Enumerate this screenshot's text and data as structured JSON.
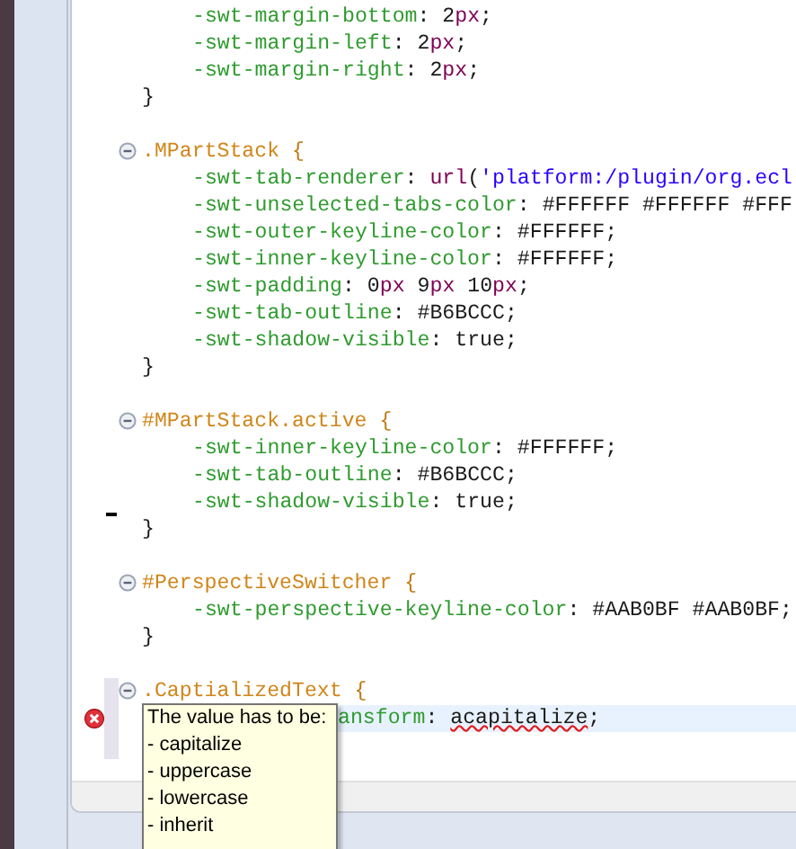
{
  "editor": {
    "lines": [
      {
        "kind": "decl",
        "tokens": [
          {
            "kind": "property",
            "text": "-swt-margin-bottom"
          },
          {
            "kind": "punct",
            "text": ": "
          },
          {
            "kind": "number",
            "text": "2"
          },
          {
            "kind": "unit",
            "text": "px"
          },
          {
            "kind": "punct",
            "text": ";"
          }
        ]
      },
      {
        "kind": "decl",
        "tokens": [
          {
            "kind": "property",
            "text": "-swt-margin-left"
          },
          {
            "kind": "punct",
            "text": ": "
          },
          {
            "kind": "number",
            "text": "2"
          },
          {
            "kind": "unit",
            "text": "px"
          },
          {
            "kind": "punct",
            "text": ";"
          }
        ]
      },
      {
        "kind": "decl",
        "tokens": [
          {
            "kind": "property",
            "text": "-swt-margin-right"
          },
          {
            "kind": "punct",
            "text": ": "
          },
          {
            "kind": "number",
            "text": "2"
          },
          {
            "kind": "unit",
            "text": "px"
          },
          {
            "kind": "punct",
            "text": ";"
          }
        ]
      },
      {
        "kind": "close",
        "tokens": [
          {
            "kind": "punct",
            "text": "}"
          }
        ]
      },
      {
        "kind": "blank"
      },
      {
        "kind": "rule",
        "tokens": [
          {
            "kind": "selector",
            "text": ".MPartStack "
          },
          {
            "kind": "brace",
            "text": "{"
          }
        ]
      },
      {
        "kind": "decl",
        "tokens": [
          {
            "kind": "property",
            "text": "-swt-tab-renderer"
          },
          {
            "kind": "punct",
            "text": ": "
          },
          {
            "kind": "unit",
            "text": "url"
          },
          {
            "kind": "punct",
            "text": "("
          },
          {
            "kind": "string",
            "text": "'platform:/plugin/org.ecl"
          }
        ]
      },
      {
        "kind": "decl",
        "tokens": [
          {
            "kind": "property",
            "text": "-swt-unselected-tabs-color"
          },
          {
            "kind": "punct",
            "text": ": #FFFFFF #FFFFFF #FFF"
          }
        ]
      },
      {
        "kind": "decl",
        "tokens": [
          {
            "kind": "property",
            "text": "-swt-outer-keyline-color"
          },
          {
            "kind": "punct",
            "text": ": #FFFFFF;"
          }
        ]
      },
      {
        "kind": "decl",
        "tokens": [
          {
            "kind": "property",
            "text": "-swt-inner-keyline-color"
          },
          {
            "kind": "punct",
            "text": ": #FFFFFF;"
          }
        ]
      },
      {
        "kind": "decl",
        "tokens": [
          {
            "kind": "property",
            "text": "-swt-padding"
          },
          {
            "kind": "punct",
            "text": ": "
          },
          {
            "kind": "number",
            "text": "0"
          },
          {
            "kind": "unit",
            "text": "px"
          },
          {
            "kind": "number",
            "text": " 9"
          },
          {
            "kind": "unit",
            "text": "px"
          },
          {
            "kind": "number",
            "text": " 10"
          },
          {
            "kind": "unit",
            "text": "px"
          },
          {
            "kind": "punct",
            "text": ";"
          }
        ]
      },
      {
        "kind": "decl",
        "tokens": [
          {
            "kind": "property",
            "text": "-swt-tab-outline"
          },
          {
            "kind": "punct",
            "text": ": #B6BCCC;"
          }
        ]
      },
      {
        "kind": "decl",
        "tokens": [
          {
            "kind": "property",
            "text": "-swt-shadow-visible"
          },
          {
            "kind": "punct",
            "text": ": true;"
          }
        ]
      },
      {
        "kind": "close",
        "tokens": [
          {
            "kind": "punct",
            "text": "}"
          }
        ]
      },
      {
        "kind": "blank"
      },
      {
        "kind": "rule",
        "tokens": [
          {
            "kind": "selector",
            "text": "#MPartStack.active "
          },
          {
            "kind": "brace",
            "text": "{"
          }
        ]
      },
      {
        "kind": "decl",
        "tokens": [
          {
            "kind": "property",
            "text": "-swt-inner-keyline-color"
          },
          {
            "kind": "punct",
            "text": ": #FFFFFF;"
          }
        ]
      },
      {
        "kind": "decl",
        "tokens": [
          {
            "kind": "property",
            "text": "-swt-tab-outline"
          },
          {
            "kind": "punct",
            "text": ": #B6BCCC;"
          }
        ]
      },
      {
        "kind": "decl",
        "marker": true,
        "tokens": [
          {
            "kind": "property",
            "text": "-swt-shadow-visible"
          },
          {
            "kind": "punct",
            "text": ": true;"
          }
        ]
      },
      {
        "kind": "close",
        "tokens": [
          {
            "kind": "punct",
            "text": "}"
          }
        ]
      },
      {
        "kind": "blank"
      },
      {
        "kind": "rule",
        "tokens": [
          {
            "kind": "selector",
            "text": "#PerspectiveSwitcher "
          },
          {
            "kind": "brace",
            "text": "{"
          }
        ]
      },
      {
        "kind": "decl",
        "tokens": [
          {
            "kind": "property",
            "text": "-swt-perspective-keyline-color"
          },
          {
            "kind": "punct",
            "text": ": #AAB0BF #AAB0BF;"
          }
        ]
      },
      {
        "kind": "close",
        "tokens": [
          {
            "kind": "punct",
            "text": "}"
          }
        ]
      },
      {
        "kind": "blank"
      },
      {
        "kind": "rule",
        "range": true,
        "tokens": [
          {
            "kind": "selector",
            "text": ".CaptializedText "
          },
          {
            "kind": "brace",
            "text": "{"
          }
        ]
      },
      {
        "kind": "partial",
        "range": true,
        "error": true,
        "selected": true,
        "tokens": [
          {
            "kind": "property",
            "text": "ansform"
          },
          {
            "kind": "punct",
            "text": ": "
          },
          {
            "kind": "invalid",
            "text": "acapitalize"
          },
          {
            "kind": "punct",
            "text": ";"
          }
        ]
      },
      {
        "kind": "blank",
        "range": true
      }
    ]
  },
  "tooltip": {
    "title": "The value has to be:",
    "items": [
      "- capitalize",
      "- uppercase",
      "- lowercase",
      "- inherit"
    ]
  }
}
